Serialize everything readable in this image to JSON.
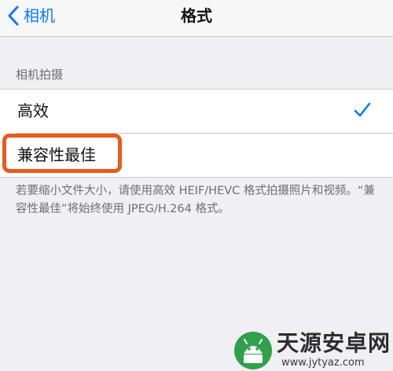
{
  "nav": {
    "back_label": "相机",
    "title": "格式"
  },
  "section": {
    "header": "相机拍摄",
    "options": [
      {
        "label": "高效",
        "selected": true
      },
      {
        "label": "兼容性最佳",
        "selected": false
      }
    ],
    "footer": "若要缩小文件大小，请使用高效 HEIF/HEVC 格式拍摄照片和视频。“兼容性最佳”将始终使用 JPEG/H.264 格式。"
  },
  "highlight": {
    "color": "#ea5a19"
  },
  "watermark": {
    "name": "天源安卓网",
    "url": "www.jytyaz.com"
  },
  "icons": {
    "back": "chevron-left-icon",
    "check": "checkmark-icon",
    "logo": "android-logo-icon"
  },
  "colors": {
    "accent": "#0a7aff",
    "background": "#efeff4"
  }
}
